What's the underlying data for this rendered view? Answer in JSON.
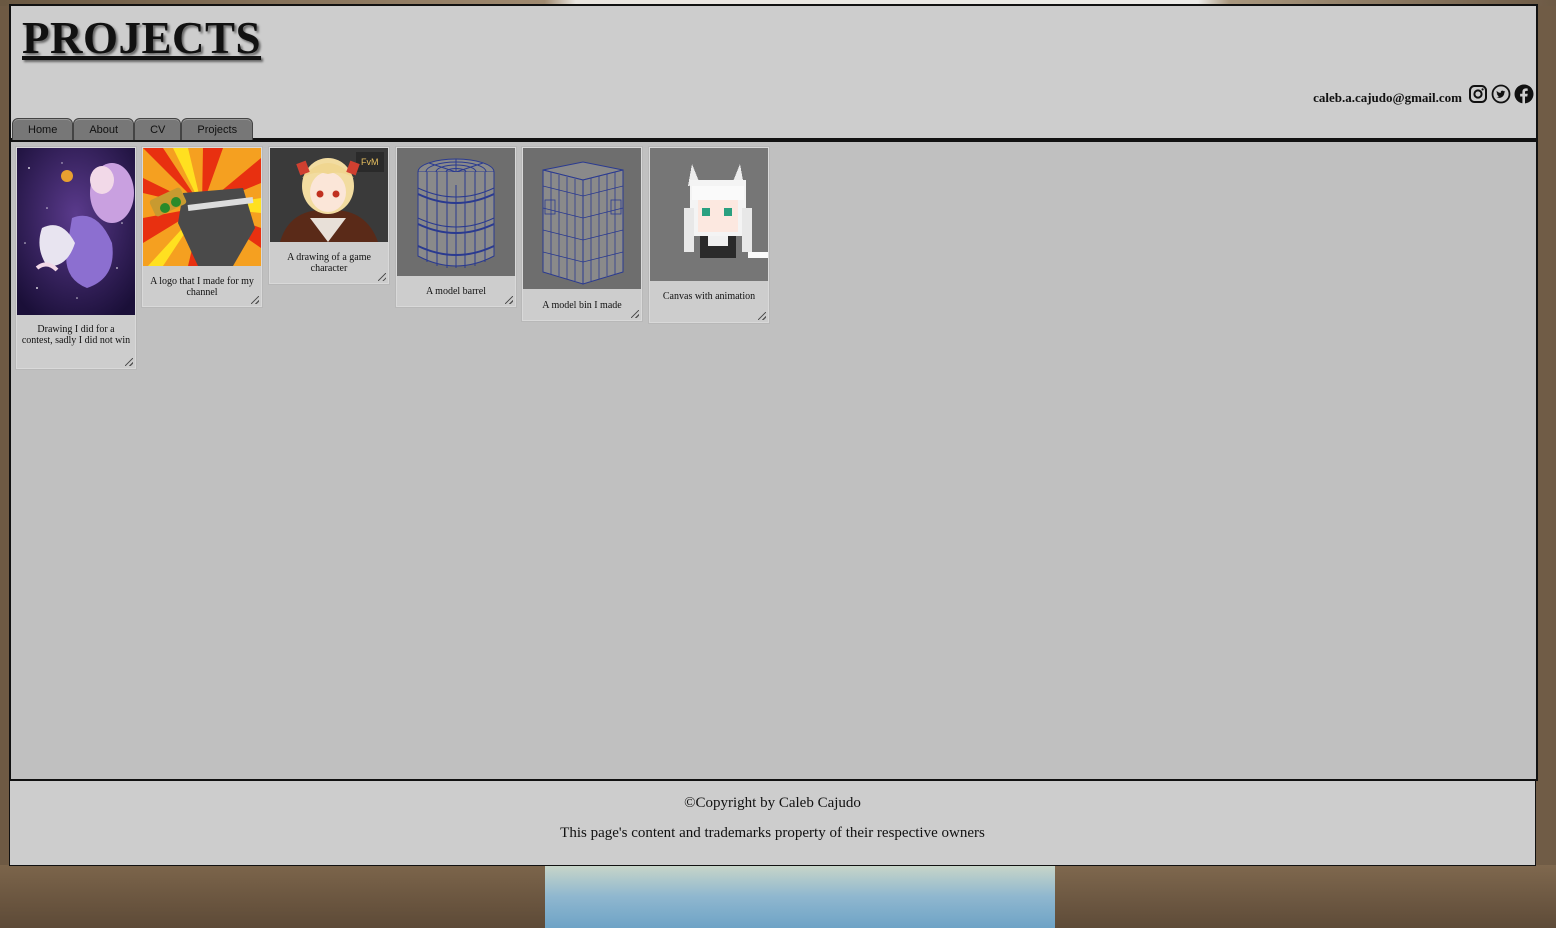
{
  "page": {
    "title": "PROJECTS",
    "email": "caleb.a.cajudo@gmail.com",
    "social": [
      "instagram-icon",
      "twitter-icon",
      "facebook-icon"
    ]
  },
  "nav": {
    "items": [
      {
        "label": "Home"
      },
      {
        "label": "About"
      },
      {
        "label": "CV"
      },
      {
        "label": "Projects"
      }
    ]
  },
  "gallery": {
    "items": [
      {
        "caption": "Drawing I did for a contest, sadly I did not win",
        "image": "purple-haired-girl-drawing"
      },
      {
        "caption": "A logo that I made for my channel",
        "image": "comic-logo"
      },
      {
        "caption": "A drawing of a game character",
        "image": "anime-character-drawing"
      },
      {
        "caption": "A model barrel",
        "image": "barrel-wireframe"
      },
      {
        "caption": "A model bin I made",
        "image": "bin-wireframe"
      },
      {
        "caption": "Canvas with animation",
        "image": "pixel-fox-girl"
      }
    ]
  },
  "footer": {
    "copyright": "©Copyright by Caleb Cajudo",
    "notice": "This page's content and trademarks property of their respective owners"
  }
}
